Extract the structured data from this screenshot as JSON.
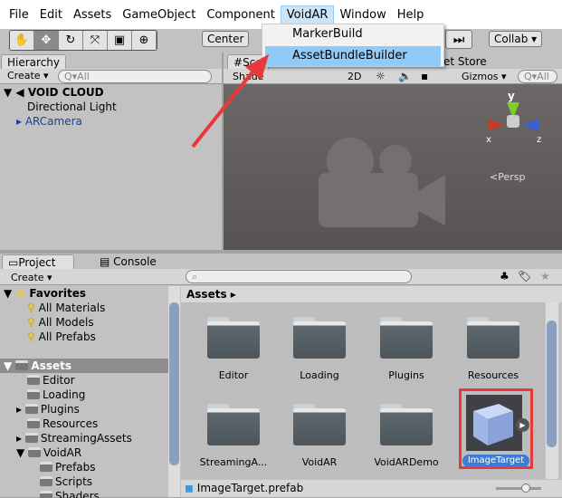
{
  "menu": [
    "File",
    "Edit",
    "Assets",
    "GameObject",
    "Component",
    "VoidAR",
    "Window",
    "Help"
  ],
  "dropdown": {
    "items": [
      "MarkerBuild",
      "AssetBundleBuilder"
    ],
    "highlighted": "AssetBundleBuilder"
  },
  "toolbar": {
    "tools": [
      "hand-icon",
      "move-icon",
      "rotate-icon",
      "scale-icon",
      "rect-icon",
      "transform-icon"
    ],
    "pivot": "Center",
    "collab": "Collab ▾"
  },
  "hierarchy": {
    "tab": "Hierarchy",
    "create": "Create ▾",
    "search_placeholder": "Q▾All",
    "scene": "VOID CLOUD",
    "items": [
      "Directional Light",
      "ARCamera"
    ]
  },
  "scene": {
    "tab": "Sce",
    "store_tab": "et Store",
    "shaded": "Shade",
    "mode2d": "2D",
    "gizmos": "Gizmos ▾",
    "search_placeholder": "Q▾All",
    "axis_y": "y",
    "axis_x": "x",
    "axis_z": "z",
    "persp": "<Persp"
  },
  "project": {
    "tab": "Project",
    "console_tab": "Console",
    "create": "Create ▾",
    "favorites": {
      "label": "Favorites",
      "items": [
        "All Materials",
        "All Models",
        "All Prefabs"
      ]
    },
    "assets_root": "Assets",
    "tree": [
      "Editor",
      "Loading",
      "Plugins",
      "Resources",
      "StreamingAssets",
      "VoidAR"
    ],
    "voidar_children": [
      "Prefabs",
      "Scripts",
      "Shaders"
    ],
    "breadcrumb": "Assets ▸",
    "grid": [
      "Editor",
      "Loading",
      "Plugins",
      "Resources",
      "StreamingA...",
      "VoidAR",
      "VoidARDemo"
    ],
    "selected": "ImageTarget",
    "status": "ImageTarget.prefab"
  },
  "colors": {
    "annotation": "#e8383a",
    "selection": "#3d7bd9"
  }
}
